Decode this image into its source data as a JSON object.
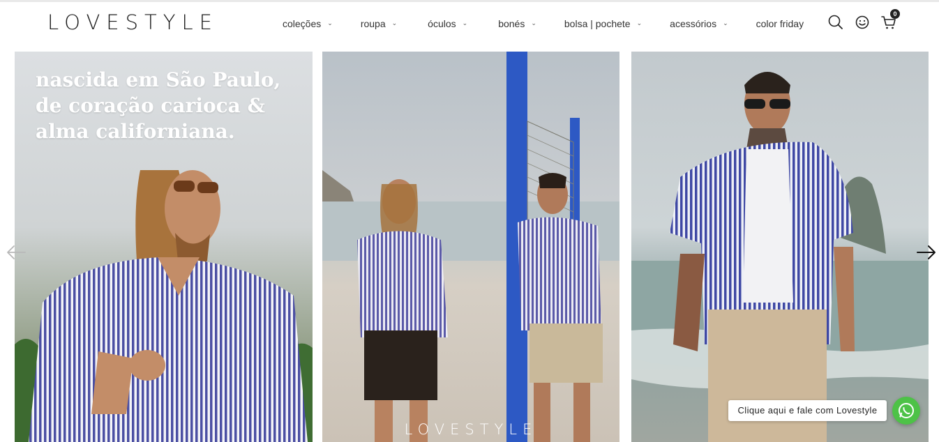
{
  "brand": {
    "logo_text": "LOVESTYLE"
  },
  "nav": {
    "items": [
      {
        "label": "coleções",
        "has_dropdown": true
      },
      {
        "label": "roupa",
        "has_dropdown": true
      },
      {
        "label": "óculos",
        "has_dropdown": true
      },
      {
        "label": "bonés",
        "has_dropdown": true
      },
      {
        "label": "bolsa | pochete",
        "has_dropdown": true
      },
      {
        "label": "acessórios",
        "has_dropdown": true
      },
      {
        "label": "color friday",
        "has_dropdown": false
      }
    ],
    "chevron_glyph": "⌄"
  },
  "header_icons": {
    "search": "search-icon",
    "account": "smiley-icon",
    "cart": "cart-icon",
    "cart_count": "0"
  },
  "hero": {
    "headline": "nascida em São Paulo, de coração carioca & alma californiana.",
    "watermark": "LOVESTYLE",
    "prev_arrow": "arrow-left-icon",
    "next_arrow": "arrow-right-icon"
  },
  "chat": {
    "bubble_text": "Clique aqui e fale com Lovestyle",
    "icon": "whatsapp-icon",
    "color": "#4dc247"
  },
  "colors": {
    "shirt_stripe": "#4b4fa3",
    "text_dark": "#222222"
  }
}
